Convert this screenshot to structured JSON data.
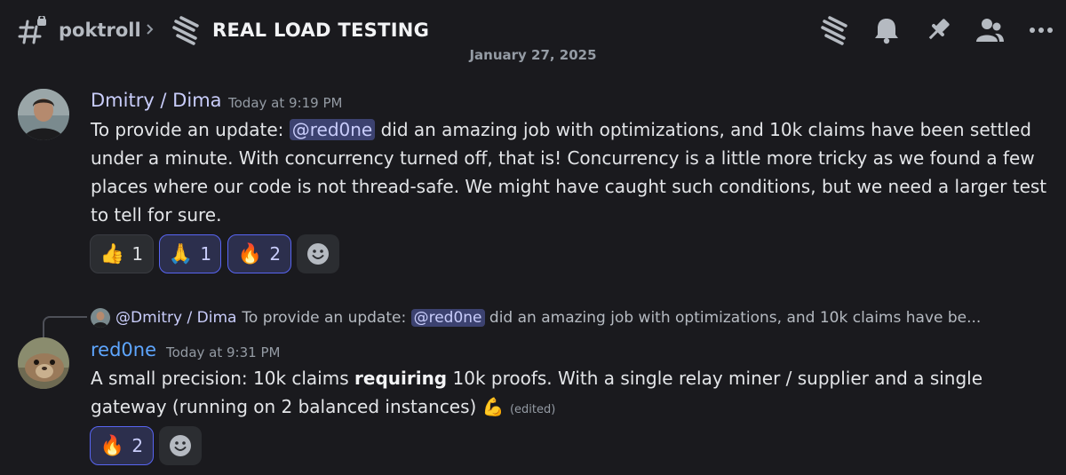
{
  "header": {
    "server": "poktroll",
    "thread_title": "REAL LOAD TESTING",
    "icons": [
      "threads-icon",
      "bell-icon",
      "pin-icon",
      "members-icon",
      "more-icon"
    ]
  },
  "date_divider": "January 27, 2025",
  "messages": [
    {
      "author": "Dmitry / Dima",
      "timestamp": "Today at 9:19 PM",
      "text_before": "To provide an update: ",
      "mention": "@red0ne",
      "text_after": " did an amazing job with optimizations, and 10k claims have been settled under a minute. With concurrency turned off, that is! Concurrency is a little more tricky as we found a few places where our code is not thread-safe. We might have caught such conditions, but we need a larger test to tell for sure.",
      "reactions": [
        {
          "emoji": "👍",
          "count": "1",
          "active": false
        },
        {
          "emoji": "🙏",
          "count": "1",
          "active": true
        },
        {
          "emoji": "🔥",
          "count": "2",
          "active": true
        }
      ]
    },
    {
      "reply_to": {
        "author": "@Dmitry / Dima",
        "text_before": "To provide an update: ",
        "mention": "@red0ne",
        "text_after": " did an amazing job with optimizations, and 10k claims have be..."
      },
      "author": "red0ne",
      "timestamp": "Today at 9:31 PM",
      "text_1": "A small precision: 10k claims ",
      "text_bold": "requiring",
      "text_2": " 10k proofs. With a single relay miner / supplier and a single gateway (running on 2 balanced instances) ",
      "emoji": "💪",
      "edited": "(edited)",
      "reactions": [
        {
          "emoji": "🔥",
          "count": "2",
          "active": true
        }
      ]
    }
  ]
}
